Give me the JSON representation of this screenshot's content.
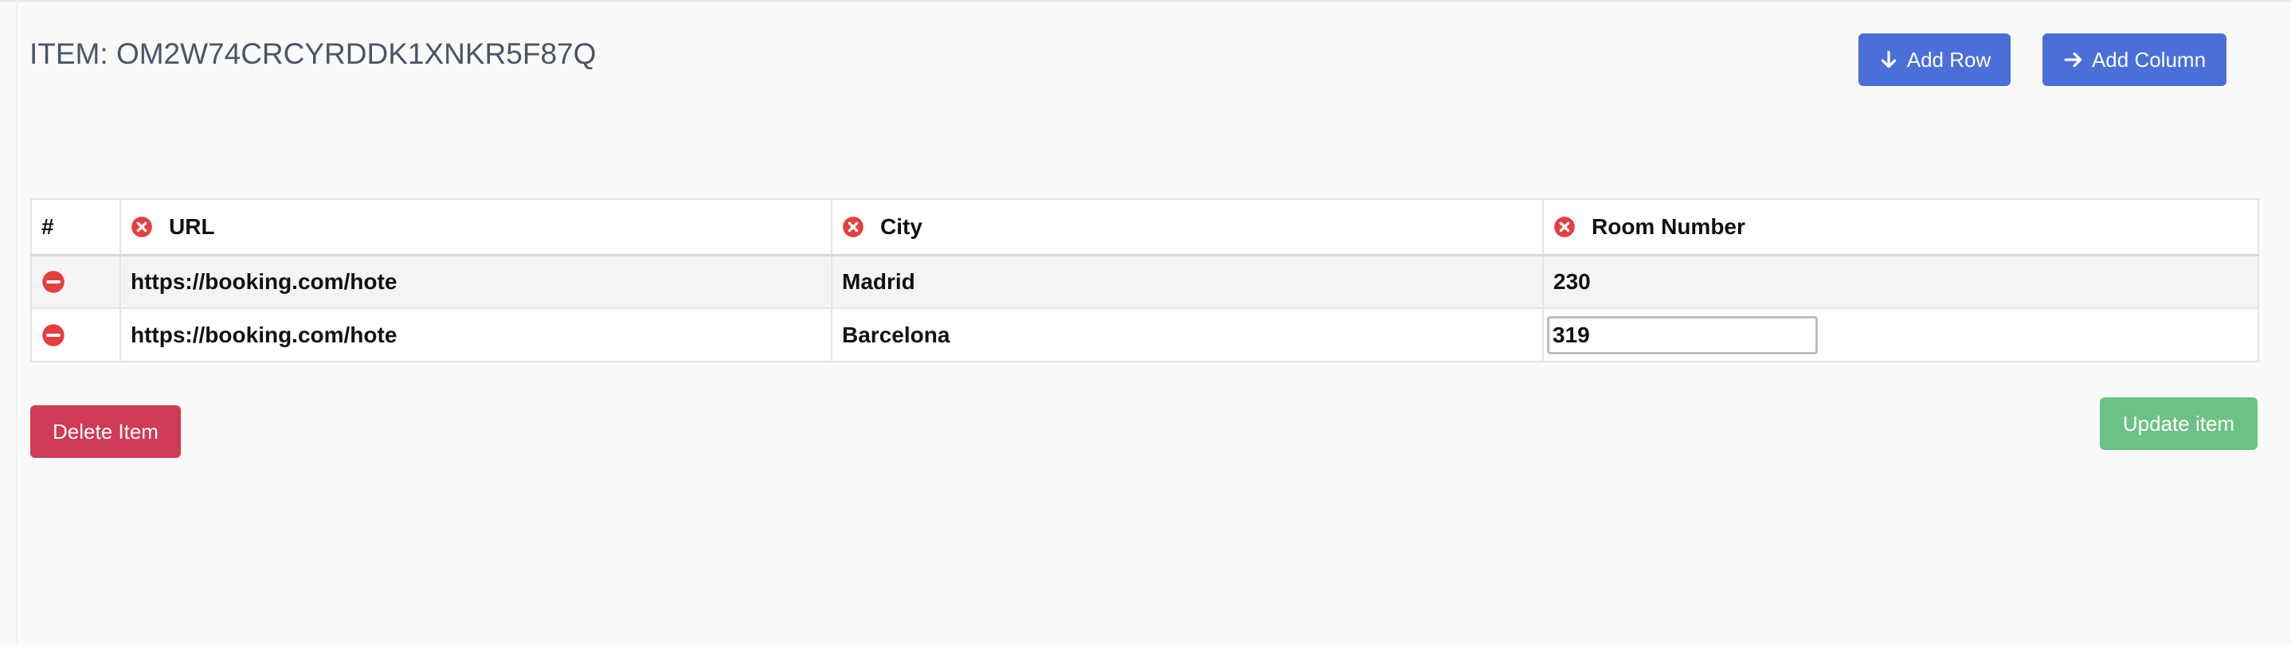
{
  "header": {
    "item_label": "ITEM:",
    "item_id": "OM2W74CRCYRDDK1XNKR5F87Q"
  },
  "toolbar": {
    "add_row_label": "Add Row",
    "add_column_label": "Add Column"
  },
  "table": {
    "index_header": "#",
    "columns": [
      "URL",
      "City",
      "Room Number"
    ],
    "rows": [
      {
        "url": "https://booking.com/hote",
        "city": "Madrid",
        "room_number": "230"
      },
      {
        "url": "https://booking.com/hote",
        "city": "Barcelona",
        "room_number": "319"
      }
    ]
  },
  "actions": {
    "delete_label": "Delete Item",
    "update_label": "Update item"
  },
  "colors": {
    "primary": "#4a6fd8",
    "danger": "#cf3a55",
    "success": "#6cc284",
    "icon_red": "#e53e3e"
  },
  "icons": {
    "add_row": "arrow-down-icon",
    "add_column": "arrow-right-icon",
    "remove_column": "x-circle-icon",
    "remove_row": "minus-circle-icon"
  }
}
